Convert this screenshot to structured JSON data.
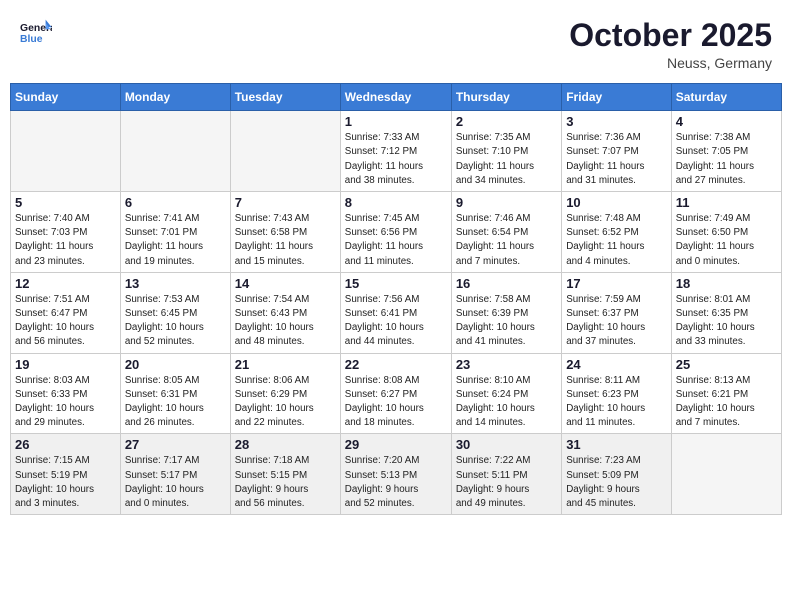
{
  "header": {
    "logo_line1": "General",
    "logo_line2": "Blue",
    "month": "October 2025",
    "location": "Neuss, Germany"
  },
  "weekdays": [
    "Sunday",
    "Monday",
    "Tuesday",
    "Wednesday",
    "Thursday",
    "Friday",
    "Saturday"
  ],
  "weeks": [
    [
      {
        "day": "",
        "info": ""
      },
      {
        "day": "",
        "info": ""
      },
      {
        "day": "",
        "info": ""
      },
      {
        "day": "1",
        "info": "Sunrise: 7:33 AM\nSunset: 7:12 PM\nDaylight: 11 hours\nand 38 minutes."
      },
      {
        "day": "2",
        "info": "Sunrise: 7:35 AM\nSunset: 7:10 PM\nDaylight: 11 hours\nand 34 minutes."
      },
      {
        "day": "3",
        "info": "Sunrise: 7:36 AM\nSunset: 7:07 PM\nDaylight: 11 hours\nand 31 minutes."
      },
      {
        "day": "4",
        "info": "Sunrise: 7:38 AM\nSunset: 7:05 PM\nDaylight: 11 hours\nand 27 minutes."
      }
    ],
    [
      {
        "day": "5",
        "info": "Sunrise: 7:40 AM\nSunset: 7:03 PM\nDaylight: 11 hours\nand 23 minutes."
      },
      {
        "day": "6",
        "info": "Sunrise: 7:41 AM\nSunset: 7:01 PM\nDaylight: 11 hours\nand 19 minutes."
      },
      {
        "day": "7",
        "info": "Sunrise: 7:43 AM\nSunset: 6:58 PM\nDaylight: 11 hours\nand 15 minutes."
      },
      {
        "day": "8",
        "info": "Sunrise: 7:45 AM\nSunset: 6:56 PM\nDaylight: 11 hours\nand 11 minutes."
      },
      {
        "day": "9",
        "info": "Sunrise: 7:46 AM\nSunset: 6:54 PM\nDaylight: 11 hours\nand 7 minutes."
      },
      {
        "day": "10",
        "info": "Sunrise: 7:48 AM\nSunset: 6:52 PM\nDaylight: 11 hours\nand 4 minutes."
      },
      {
        "day": "11",
        "info": "Sunrise: 7:49 AM\nSunset: 6:50 PM\nDaylight: 11 hours\nand 0 minutes."
      }
    ],
    [
      {
        "day": "12",
        "info": "Sunrise: 7:51 AM\nSunset: 6:47 PM\nDaylight: 10 hours\nand 56 minutes."
      },
      {
        "day": "13",
        "info": "Sunrise: 7:53 AM\nSunset: 6:45 PM\nDaylight: 10 hours\nand 52 minutes."
      },
      {
        "day": "14",
        "info": "Sunrise: 7:54 AM\nSunset: 6:43 PM\nDaylight: 10 hours\nand 48 minutes."
      },
      {
        "day": "15",
        "info": "Sunrise: 7:56 AM\nSunset: 6:41 PM\nDaylight: 10 hours\nand 44 minutes."
      },
      {
        "day": "16",
        "info": "Sunrise: 7:58 AM\nSunset: 6:39 PM\nDaylight: 10 hours\nand 41 minutes."
      },
      {
        "day": "17",
        "info": "Sunrise: 7:59 AM\nSunset: 6:37 PM\nDaylight: 10 hours\nand 37 minutes."
      },
      {
        "day": "18",
        "info": "Sunrise: 8:01 AM\nSunset: 6:35 PM\nDaylight: 10 hours\nand 33 minutes."
      }
    ],
    [
      {
        "day": "19",
        "info": "Sunrise: 8:03 AM\nSunset: 6:33 PM\nDaylight: 10 hours\nand 29 minutes."
      },
      {
        "day": "20",
        "info": "Sunrise: 8:05 AM\nSunset: 6:31 PM\nDaylight: 10 hours\nand 26 minutes."
      },
      {
        "day": "21",
        "info": "Sunrise: 8:06 AM\nSunset: 6:29 PM\nDaylight: 10 hours\nand 22 minutes."
      },
      {
        "day": "22",
        "info": "Sunrise: 8:08 AM\nSunset: 6:27 PM\nDaylight: 10 hours\nand 18 minutes."
      },
      {
        "day": "23",
        "info": "Sunrise: 8:10 AM\nSunset: 6:24 PM\nDaylight: 10 hours\nand 14 minutes."
      },
      {
        "day": "24",
        "info": "Sunrise: 8:11 AM\nSunset: 6:23 PM\nDaylight: 10 hours\nand 11 minutes."
      },
      {
        "day": "25",
        "info": "Sunrise: 8:13 AM\nSunset: 6:21 PM\nDaylight: 10 hours\nand 7 minutes."
      }
    ],
    [
      {
        "day": "26",
        "info": "Sunrise: 7:15 AM\nSunset: 5:19 PM\nDaylight: 10 hours\nand 3 minutes."
      },
      {
        "day": "27",
        "info": "Sunrise: 7:17 AM\nSunset: 5:17 PM\nDaylight: 10 hours\nand 0 minutes."
      },
      {
        "day": "28",
        "info": "Sunrise: 7:18 AM\nSunset: 5:15 PM\nDaylight: 9 hours\nand 56 minutes."
      },
      {
        "day": "29",
        "info": "Sunrise: 7:20 AM\nSunset: 5:13 PM\nDaylight: 9 hours\nand 52 minutes."
      },
      {
        "day": "30",
        "info": "Sunrise: 7:22 AM\nSunset: 5:11 PM\nDaylight: 9 hours\nand 49 minutes."
      },
      {
        "day": "31",
        "info": "Sunrise: 7:23 AM\nSunset: 5:09 PM\nDaylight: 9 hours\nand 45 minutes."
      },
      {
        "day": "",
        "info": ""
      }
    ]
  ]
}
